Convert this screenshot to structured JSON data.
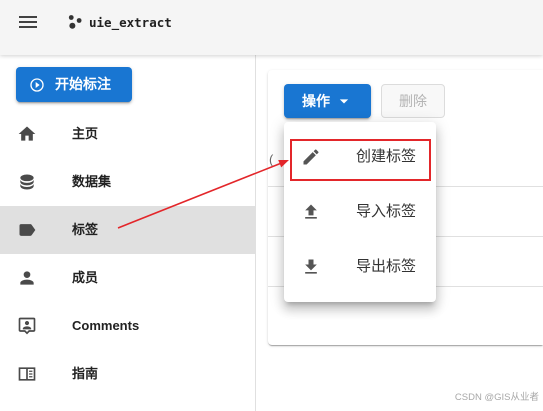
{
  "app": {
    "title": "uie_extract",
    "menu_icon": "menu-icon",
    "logo_icon": "logo-icon"
  },
  "sidebar": {
    "start_button": {
      "label": "开始标注",
      "icon": "play-circle-outline-icon"
    },
    "items": [
      {
        "label": "主页",
        "icon": "home-icon",
        "active": false
      },
      {
        "label": "数据集",
        "icon": "database-icon",
        "active": false
      },
      {
        "label": "标签",
        "icon": "label-icon",
        "active": true
      },
      {
        "label": "成员",
        "icon": "account-icon",
        "active": false
      },
      {
        "label": "Comments",
        "icon": "comment-account-icon",
        "active": false
      },
      {
        "label": "指南",
        "icon": "book-icon",
        "active": false
      }
    ]
  },
  "toolbar": {
    "actions_label": "操作",
    "actions_icon": "menu-down-icon",
    "delete_label": "删除",
    "delete_disabled": true
  },
  "actions_menu": {
    "open": true,
    "items": [
      {
        "label": "创建标签",
        "icon": "pencil-icon",
        "highlighted": true
      },
      {
        "label": "导入标签",
        "icon": "upload-icon",
        "highlighted": false
      },
      {
        "label": "导出标签",
        "icon": "download-icon",
        "highlighted": false
      }
    ]
  },
  "table": {
    "header_fragment": "("
  },
  "watermark": "CSDN @GIS从业者",
  "colors": {
    "primary": "#1976d2",
    "active_item_bg": "#e0e0e0",
    "annotation_red": "#e3262a"
  }
}
